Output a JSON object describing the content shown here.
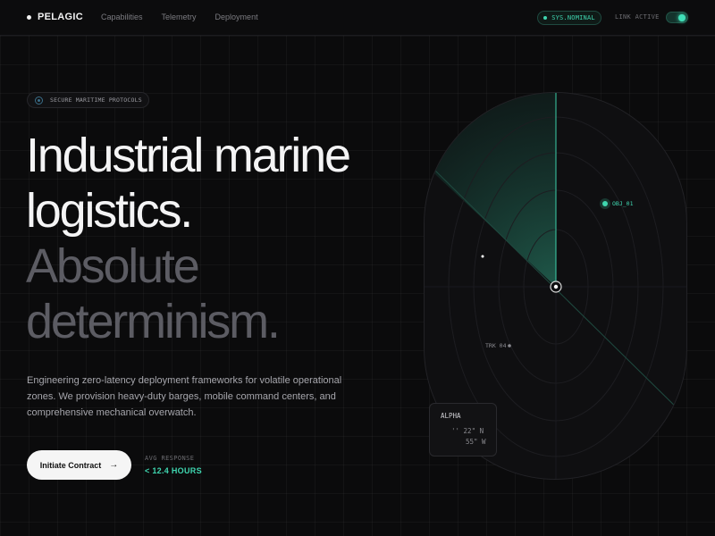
{
  "nav": {
    "brand": "PELAGIC",
    "links": [
      "Capabilities",
      "Telemetry",
      "Deployment"
    ],
    "status_pill": "SYS.NOMINAL",
    "link_label": "LINK ACTIVE"
  },
  "hero": {
    "badge": "SECURE MARITIME PROTOCOLS",
    "headline": [
      "Industrial marine",
      "logistics.",
      "Absolute",
      "determinism."
    ],
    "lead": "Engineering zero-latency deployment frameworks for volatile operational zones. We provision heavy-duty barges, mobile command centers, and comprehensive mechanical overwatch.",
    "cta_label": "Initiate Contract",
    "metric_label": "AVG RESPONSE",
    "metric_value": "< 12.4 HOURS"
  },
  "radar": {
    "tracks": [
      {
        "label": "OBJ_01",
        "accent": true
      },
      {
        "label": "TRK 04",
        "accent": false
      }
    ],
    "info_card": {
      "title": "ALPHA",
      "lat": "'' 22\" N",
      "lon": "55\" W"
    }
  },
  "colors": {
    "background": "#0b0b0c",
    "accent": "#3fd6b0",
    "text_bright": "#f4f4f5",
    "text_dim": "#5c5c63"
  },
  "icons": [
    "brand-dot-icon",
    "status-dot-icon",
    "toggle-icon",
    "shield-dot-icon",
    "arrow-right-icon",
    "radar-center-icon"
  ]
}
